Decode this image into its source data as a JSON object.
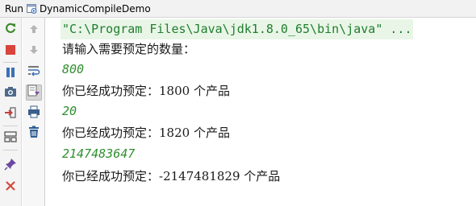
{
  "header": {
    "run_label": "Run",
    "config_name": "DynamicCompileDemo"
  },
  "toolbar_left": [
    {
      "name": "rerun-icon",
      "color": "#3e8a2e"
    },
    {
      "name": "stop-icon",
      "color": "#d9443b"
    },
    {
      "name": "pause-icon",
      "color": "#3a6fb7"
    },
    {
      "name": "camera-icon",
      "color": "#4d6a8a"
    },
    {
      "name": "login-icon",
      "color": "#c04040"
    },
    {
      "name": "layout-icon",
      "color": "#4a4a4a"
    },
    {
      "name": "pin-icon",
      "color": "#6a4aa0"
    },
    {
      "name": "close-icon",
      "color": "#d24a3c"
    }
  ],
  "toolbar_right": [
    {
      "name": "arrow-up-icon"
    },
    {
      "name": "arrow-down-icon"
    },
    {
      "name": "soft-wrap-icon"
    },
    {
      "name": "scroll-to-end-icon"
    },
    {
      "name": "print-icon"
    },
    {
      "name": "trash-icon"
    }
  ],
  "console": {
    "command_line": "\"C:\\Program Files\\Java\\jdk1.8.0_65\\bin\\java\" ...",
    "lines": [
      {
        "type": "out",
        "text": "请输入需要预定的数量："
      },
      {
        "type": "input",
        "text": "800"
      },
      {
        "type": "out",
        "text": "你已经成功预定：1800 个产品"
      },
      {
        "type": "input",
        "text": "20"
      },
      {
        "type": "out",
        "text": "你已经成功预定：1820 个产品"
      },
      {
        "type": "input",
        "text": "2147483647"
      },
      {
        "type": "out",
        "text": "你已经成功预定：-2147481829 个产品"
      }
    ]
  },
  "colors": {
    "input_text": "#2f8f2f",
    "command_text": "#1f7d2e",
    "command_bg": "#e9f6e7",
    "output_text": "#1a1a1a"
  }
}
